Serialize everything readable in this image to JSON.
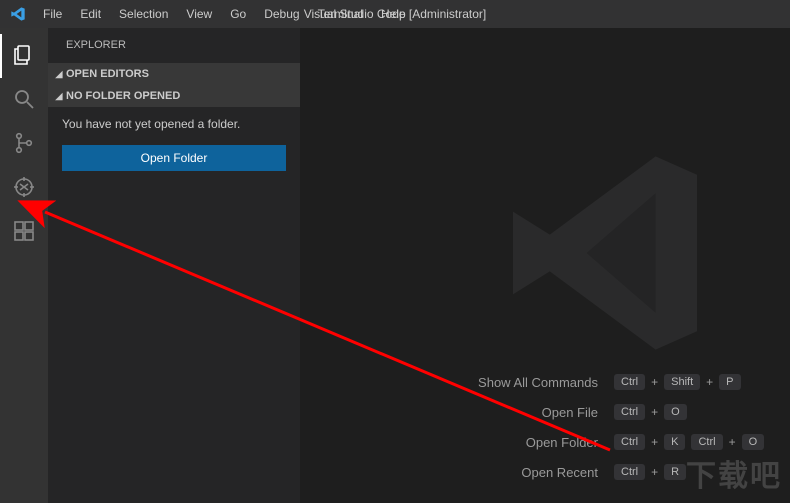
{
  "titlebar": {
    "title": "Visual Studio Code [Administrator]",
    "menu": [
      "File",
      "Edit",
      "Selection",
      "View",
      "Go",
      "Debug",
      "Terminal",
      "Help"
    ]
  },
  "activitybar": {
    "items": [
      {
        "name": "explorer-icon"
      },
      {
        "name": "search-icon"
      },
      {
        "name": "source-control-icon"
      },
      {
        "name": "debug-icon"
      },
      {
        "name": "extensions-icon"
      }
    ]
  },
  "sidebar": {
    "title": "EXPLORER",
    "sections": {
      "open_editors": "OPEN EDITORS",
      "no_folder": "NO FOLDER OPENED"
    },
    "no_folder_msg": "You have not yet opened a folder.",
    "open_folder_btn": "Open Folder"
  },
  "welcome": {
    "commands": [
      {
        "label": "Show All Commands",
        "keys": [
          "Ctrl",
          "Shift",
          "P"
        ]
      },
      {
        "label": "Open File",
        "keys": [
          "Ctrl",
          "O"
        ]
      },
      {
        "label": "Open Folder",
        "keys": [
          "Ctrl",
          "K",
          "Ctrl",
          "O"
        ]
      },
      {
        "label": "Open Recent",
        "keys": [
          "Ctrl",
          "R"
        ]
      }
    ]
  },
  "watermark": "下载吧",
  "colors": {
    "accent": "#0e639c",
    "bg": "#1e1e1e",
    "sidebar": "#252526",
    "activity": "#333333",
    "titlebar": "#323233"
  }
}
